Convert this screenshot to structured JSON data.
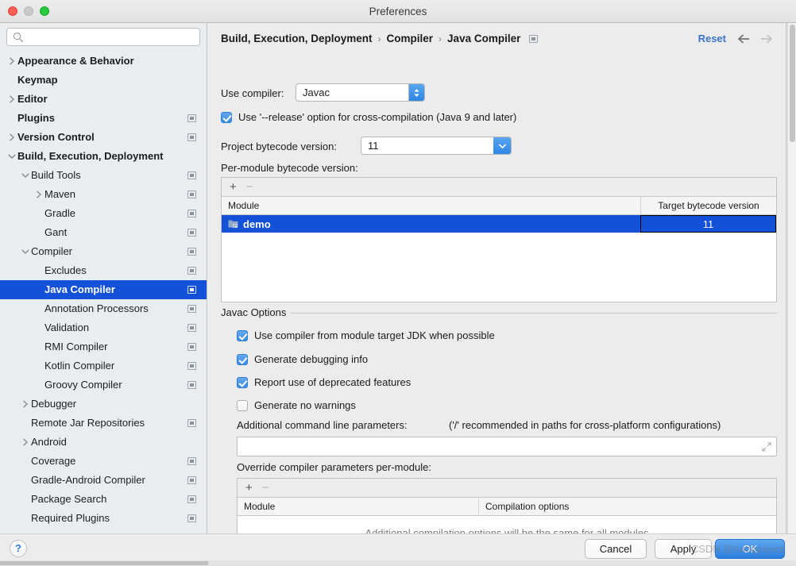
{
  "window": {
    "title": "Preferences",
    "traffic_lights": [
      "close",
      "minimize",
      "zoom"
    ]
  },
  "sidebar": {
    "search_placeholder": "",
    "search_value": "",
    "items": [
      {
        "label": "Appearance & Behavior",
        "indent": 0,
        "twisty": "right",
        "bold": true,
        "cfg": false,
        "selected": false
      },
      {
        "label": "Keymap",
        "indent": 0,
        "twisty": "none",
        "bold": true,
        "cfg": false,
        "selected": false
      },
      {
        "label": "Editor",
        "indent": 0,
        "twisty": "right",
        "bold": true,
        "cfg": false,
        "selected": false
      },
      {
        "label": "Plugins",
        "indent": 0,
        "twisty": "none",
        "bold": true,
        "cfg": true,
        "selected": false
      },
      {
        "label": "Version Control",
        "indent": 0,
        "twisty": "right",
        "bold": true,
        "cfg": true,
        "selected": false
      },
      {
        "label": "Build, Execution, Deployment",
        "indent": 0,
        "twisty": "down",
        "bold": true,
        "cfg": false,
        "selected": false
      },
      {
        "label": "Build Tools",
        "indent": 1,
        "twisty": "down",
        "bold": false,
        "cfg": true,
        "selected": false
      },
      {
        "label": "Maven",
        "indent": 2,
        "twisty": "right",
        "bold": false,
        "cfg": true,
        "selected": false
      },
      {
        "label": "Gradle",
        "indent": 2,
        "twisty": "none",
        "bold": false,
        "cfg": true,
        "selected": false
      },
      {
        "label": "Gant",
        "indent": 2,
        "twisty": "none",
        "bold": false,
        "cfg": true,
        "selected": false
      },
      {
        "label": "Compiler",
        "indent": 1,
        "twisty": "down",
        "bold": false,
        "cfg": true,
        "selected": false
      },
      {
        "label": "Excludes",
        "indent": 2,
        "twisty": "none",
        "bold": false,
        "cfg": true,
        "selected": false
      },
      {
        "label": "Java Compiler",
        "indent": 2,
        "twisty": "none",
        "bold": true,
        "cfg": true,
        "selected": true
      },
      {
        "label": "Annotation Processors",
        "indent": 2,
        "twisty": "none",
        "bold": false,
        "cfg": true,
        "selected": false
      },
      {
        "label": "Validation",
        "indent": 2,
        "twisty": "none",
        "bold": false,
        "cfg": true,
        "selected": false
      },
      {
        "label": "RMI Compiler",
        "indent": 2,
        "twisty": "none",
        "bold": false,
        "cfg": true,
        "selected": false
      },
      {
        "label": "Kotlin Compiler",
        "indent": 2,
        "twisty": "none",
        "bold": false,
        "cfg": true,
        "selected": false
      },
      {
        "label": "Groovy Compiler",
        "indent": 2,
        "twisty": "none",
        "bold": false,
        "cfg": true,
        "selected": false
      },
      {
        "label": "Debugger",
        "indent": 1,
        "twisty": "right",
        "bold": false,
        "cfg": false,
        "selected": false
      },
      {
        "label": "Remote Jar Repositories",
        "indent": 1,
        "twisty": "none",
        "bold": false,
        "cfg": true,
        "selected": false
      },
      {
        "label": "Android",
        "indent": 1,
        "twisty": "right",
        "bold": false,
        "cfg": false,
        "selected": false
      },
      {
        "label": "Coverage",
        "indent": 1,
        "twisty": "none",
        "bold": false,
        "cfg": true,
        "selected": false
      },
      {
        "label": "Gradle-Android Compiler",
        "indent": 1,
        "twisty": "none",
        "bold": false,
        "cfg": true,
        "selected": false
      },
      {
        "label": "Package Search",
        "indent": 1,
        "twisty": "none",
        "bold": false,
        "cfg": true,
        "selected": false
      },
      {
        "label": "Required Plugins",
        "indent": 1,
        "twisty": "none",
        "bold": false,
        "cfg": true,
        "selected": false
      }
    ]
  },
  "main": {
    "breadcrumb": {
      "part1": "Build, Execution, Deployment",
      "sep1": "›",
      "part2": "Compiler",
      "sep2": "›",
      "part3": "Java Compiler"
    },
    "reset_label": "Reset",
    "use_compiler": {
      "label": "Use compiler:",
      "value": "Javac"
    },
    "release_option": {
      "label": "Use '--release' option for cross-compilation (Java 9 and later)",
      "checked": true
    },
    "project_bytecode": {
      "label": "Project bytecode version:",
      "value": "11"
    },
    "per_module_bytecode": {
      "label": "Per-module bytecode version:",
      "add_icon": "+",
      "remove_icon": "−",
      "columns": [
        "Module",
        "Target bytecode version"
      ],
      "rows": [
        {
          "module": "demo",
          "target": "11",
          "selected": true,
          "editing": true
        }
      ]
    },
    "javac_options": {
      "title": "Javac Options",
      "checkboxes": [
        {
          "label": "Use compiler from module target JDK when possible",
          "checked": true
        },
        {
          "label": "Generate debugging info",
          "checked": true
        },
        {
          "label": "Report use of deprecated features",
          "checked": true
        },
        {
          "label": "Generate no warnings",
          "checked": false
        }
      ],
      "additional_params_label": "Additional command line parameters:",
      "additional_params_hint": "('/' recommended in paths for cross-platform configurations)",
      "additional_params_value": "",
      "override_label": "Override compiler parameters per-module:",
      "override_add_icon": "+",
      "override_remove_icon": "−",
      "override_columns": [
        "Module",
        "Compilation options"
      ],
      "override_empty_message": "Additional compilation options will be the same for all modules"
    }
  },
  "footer": {
    "help_label": "?",
    "cancel_label": "Cancel",
    "apply_label": "Apply",
    "ok_label": "OK"
  },
  "watermark": "CSDN @haogeoyes",
  "colors": {
    "selection_blue": "#1351d8",
    "accent_blue": "#3a74c8",
    "ok_button": "#2a7fe0",
    "sidebar_bg": "#e9edf0",
    "panel_bg": "#ececec"
  }
}
